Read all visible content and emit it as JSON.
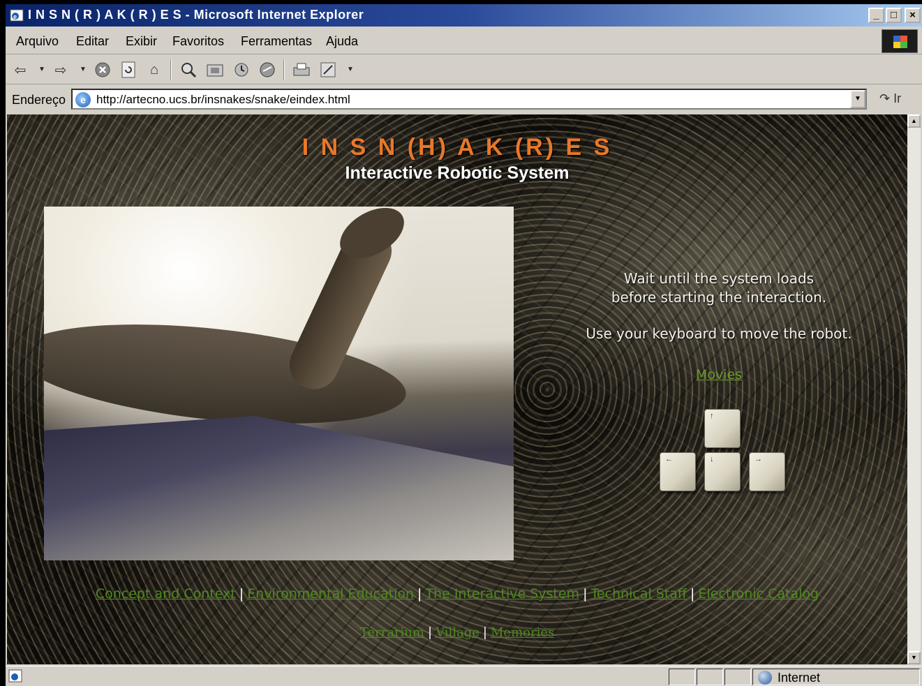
{
  "window": {
    "title": "I N S N ( R ) A K ( R ) E S - Microsoft Internet Explorer",
    "min_glyph": "_",
    "max_glyph": "□",
    "close_glyph": "×"
  },
  "menu": {
    "items": [
      "Arquivo",
      "Editar",
      "Exibir",
      "Favoritos",
      "Ferramentas",
      "Ajuda"
    ]
  },
  "toolbar": {
    "icons": [
      "back-icon",
      "forward-icon",
      "stop-icon",
      "refresh-icon",
      "home-icon",
      "search-icon",
      "favorites-icon",
      "history-icon",
      "media-icon",
      "print-icon",
      "edit-icon"
    ]
  },
  "address": {
    "label": "Endereço",
    "url": "http://artecno.ucs.br/insnakes/snake/eindex.html",
    "go_label": "Ir"
  },
  "page": {
    "title": "I N S N (H) A K (R) E S",
    "subtitle": "Interactive Robotic System",
    "instruction_line1": "Wait until the system loads",
    "instruction_line2": "before starting the interaction.",
    "instruction_line3": "Use your keyboard to move the robot.",
    "movies_link": "Movies",
    "keys": {
      "up": "↑",
      "left": "←",
      "down": "↓",
      "right": "→"
    },
    "nav_primary": [
      "Concept and Context",
      "Environmental Education",
      "The Interactive System",
      "Technical Staff",
      "Electronic Catalog"
    ],
    "nav_secondary": [
      "Terrarium",
      "Village",
      "Memories"
    ],
    "nav_separator": "|"
  },
  "status": {
    "zone": "Internet"
  },
  "colors": {
    "title_orange": "#e8782a",
    "link_green": "#4f8a1e",
    "titlebar_blue": "#0a246a"
  }
}
